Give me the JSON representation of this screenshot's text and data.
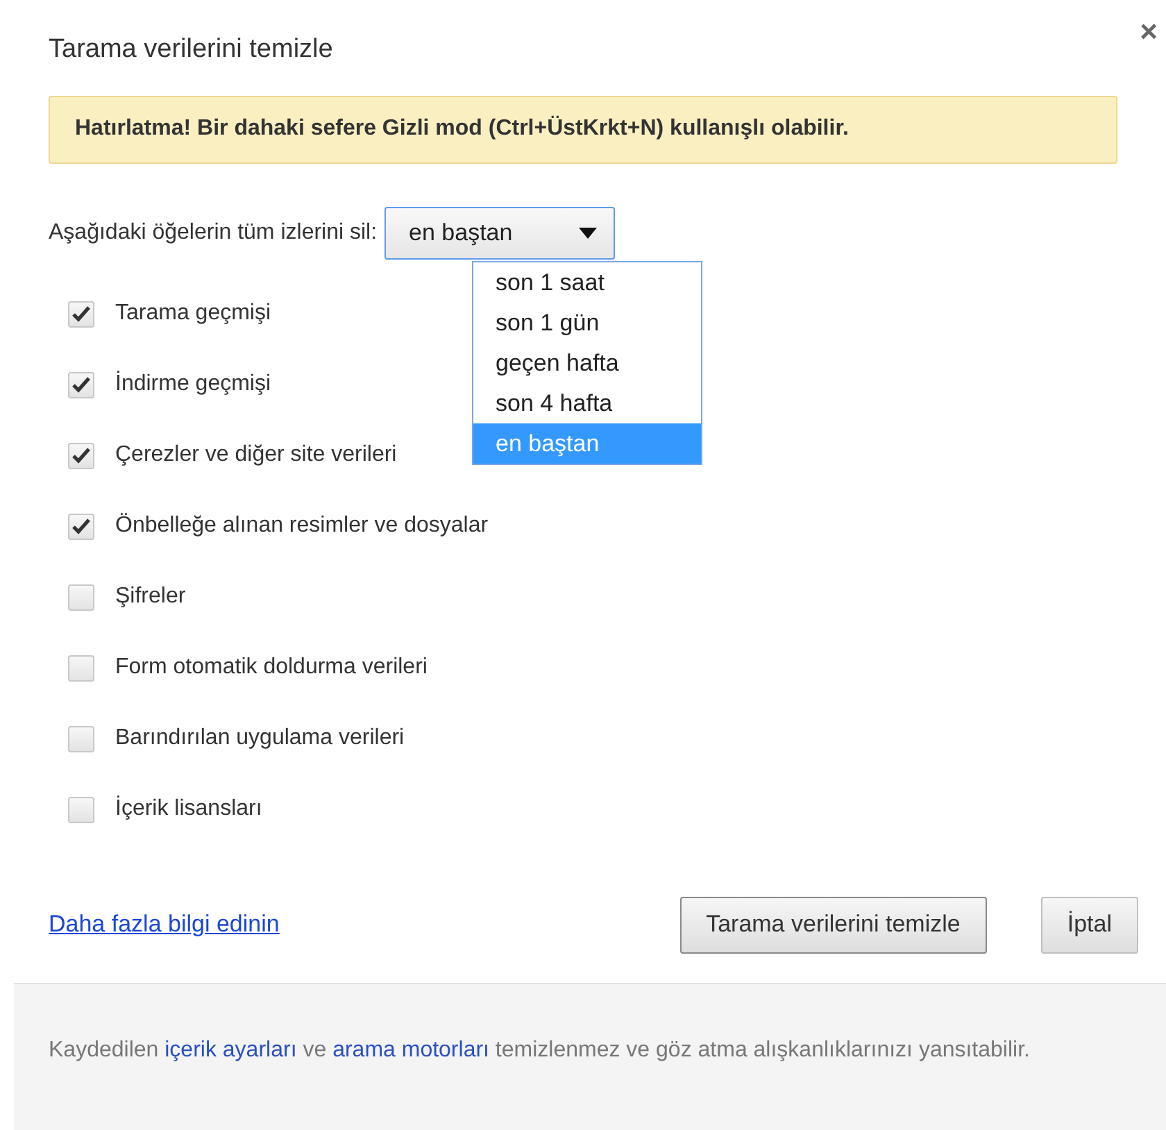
{
  "dialog": {
    "title": "Tarama verilerini temizle",
    "close": "×"
  },
  "banner": {
    "text": "Hatırlatma! Bir dahaki sefere Gizli mod (Ctrl+ÜstKrkt+N) kullanışlı olabilir."
  },
  "range": {
    "label": "Aşağıdaki öğelerin tüm izlerini sil:",
    "value": "en baştan",
    "expanded": true,
    "options": [
      {
        "label": "son 1 saat",
        "selected": false
      },
      {
        "label": "son 1 gün",
        "selected": false
      },
      {
        "label": "geçen hafta",
        "selected": false
      },
      {
        "label": "son 4 hafta",
        "selected": false
      },
      {
        "label": "en baştan",
        "selected": true
      }
    ]
  },
  "items": [
    {
      "label": "Tarama geçmişi",
      "checked": true
    },
    {
      "label": "İndirme geçmişi",
      "checked": true
    },
    {
      "label": "Çerezler ve diğer site verileri",
      "checked": true
    },
    {
      "label": "Önbelleğe alınan resimler ve dosyalar",
      "checked": true
    },
    {
      "label": "Şifreler",
      "checked": false
    },
    {
      "label": "Form otomatik doldurma verileri",
      "checked": false
    },
    {
      "label": "Barındırılan uygulama verileri",
      "checked": false
    },
    {
      "label": "İçerik lisansları",
      "checked": false
    }
  ],
  "link": "Daha fazla bilgi edinin",
  "buttons": [
    "Tarama verilerini temizle",
    "İptal"
  ],
  "footer": [
    {
      "kind": "text",
      "text": "Kaydedilen "
    },
    {
      "kind": "link",
      "text": "içerik ayarları"
    },
    {
      "kind": "text",
      "text": " ve "
    },
    {
      "kind": "link",
      "text": "arama motorları"
    },
    {
      "kind": "text",
      "text": " temizlenmez ve göz atma alışkanlıklarınızı yansıtabilir."
    }
  ]
}
